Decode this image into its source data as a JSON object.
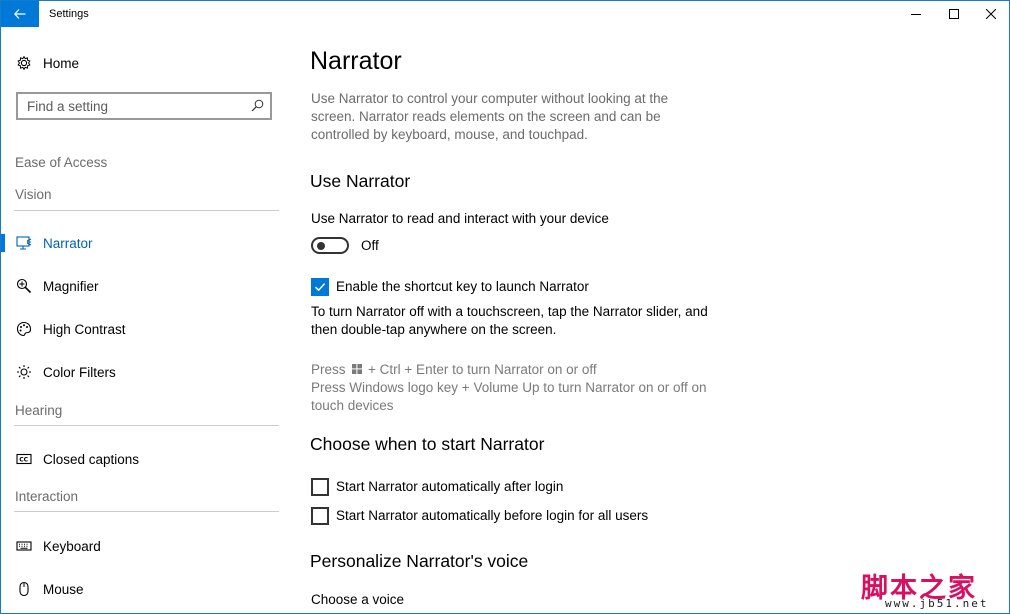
{
  "window": {
    "title": "Settings"
  },
  "sidebar": {
    "home_label": "Home",
    "search_placeholder": "Find a setting",
    "category": "Ease of Access",
    "groups": {
      "vision": "Vision",
      "hearing": "Hearing",
      "interaction": "Interaction"
    },
    "items": {
      "narrator": "Narrator",
      "magnifier": "Magnifier",
      "high_contrast": "High Contrast",
      "color_filters": "Color Filters",
      "closed_captions": "Closed captions",
      "keyboard": "Keyboard",
      "mouse": "Mouse"
    }
  },
  "main": {
    "title": "Narrator",
    "description": "Use Narrator to control your computer without looking at the screen. Narrator reads elements on the screen and can be controlled by keyboard, mouse, and touchpad.",
    "use_narrator": {
      "heading": "Use Narrator",
      "toggle_caption": "Use Narrator to read and interact with your device",
      "toggle_state": "Off",
      "toggle_on": false,
      "shortcut_checkbox_label": "Enable the shortcut key to launch Narrator",
      "shortcut_checked": true,
      "touch_hint": "To turn Narrator off with a touchscreen, tap the Narrator slider, and then double-tap anywhere on the screen.",
      "press_prefix": "Press",
      "press_suffix": "+ Ctrl + Enter to turn Narrator on or off",
      "press_line2": "Press Windows logo key + Volume Up to turn Narrator on or off on touch devices"
    },
    "start": {
      "heading": "Choose when to start Narrator",
      "after_login_label": "Start Narrator automatically after login",
      "after_login_checked": false,
      "before_login_label": "Start Narrator automatically before login for all users",
      "before_login_checked": false
    },
    "voice": {
      "heading": "Personalize Narrator's voice",
      "choose_label": "Choose a voice"
    }
  },
  "watermark": {
    "text": "脚本之家",
    "url": "www.jb51.net"
  },
  "colors": {
    "accent": "#0078d7",
    "muted": "#6b6b6b",
    "watermark": "#d90f62"
  }
}
